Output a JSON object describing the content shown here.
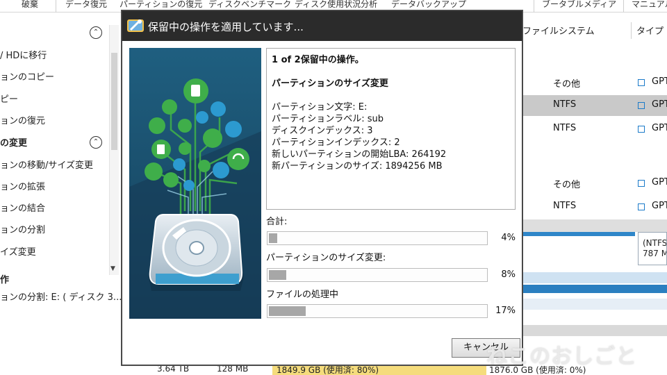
{
  "menubar": {
    "items": [
      "破棄",
      "データ復元",
      "パーティションの復元",
      "ディスクベンチマーク",
      "ディスク使用状況分析",
      "データバックアップ",
      "ブータブルメディア",
      "マニュアル"
    ]
  },
  "sidebar": {
    "items": [
      "/ HDに移行",
      "ョンのコピー",
      "ピー",
      "ョンの復元",
      "の変更",
      "ョンの移動/サイズ変更",
      "ョンの拡張",
      "ョンの結合",
      "ョンの分割",
      "イズ変更",
      "作",
      "ョンの分割: E: ( ディスク 3..."
    ],
    "collapse_glyph": "⌃"
  },
  "table": {
    "headers": [
      "ファイルシステム",
      "タイプ"
    ],
    "rows": [
      {
        "filesystem": "その他",
        "type": "GPT"
      },
      {
        "filesystem": "NTFS",
        "type": "GPT"
      },
      {
        "filesystem": "NTFS",
        "type": "GPT"
      },
      {
        "filesystem": "その他",
        "type": "GPT"
      },
      {
        "filesystem": "NTFS",
        "type": "GPT"
      }
    ],
    "disk_box_line1": "(NTFS",
    "disk_box_line2": "787 M"
  },
  "footer": {
    "cap1": "3.64 TB",
    "cap2": "128 MB",
    "cap3": "1849.9 GB (使用済: 80%)",
    "cap4": "1876.0 GB (使用済: 0%)"
  },
  "watermark": "ねこのおしごと",
  "dialog": {
    "title": "保留中の操作を適用しています...",
    "info": {
      "header": "1 of 2保留中の操作。",
      "operation": "パーティションのサイズ変更",
      "details": [
        "パーティション文字: E:",
        "パーティションラベル: sub",
        "ディスクインデックス: 3",
        "パーティションインデックス: 2",
        "新しいパーティションの開始LBA: 264192",
        "新パーティションのサイズ: 1894256 MB"
      ]
    },
    "progress": [
      {
        "label": "合計:",
        "percent_text": "4%",
        "value": 0.04
      },
      {
        "label": "パーティションのサイズ変更:",
        "percent_text": "8%",
        "value": 0.08
      },
      {
        "label": "ファイルの処理中",
        "percent_text": "17%",
        "value": 0.17
      }
    ],
    "cancel_label": "キャンセル"
  },
  "colors": {
    "titlebar": "#2b2b2b",
    "illus_bg": "#1c4f6e",
    "node_green": "#3fae4a",
    "accent_blue": "#1a7ac9"
  }
}
